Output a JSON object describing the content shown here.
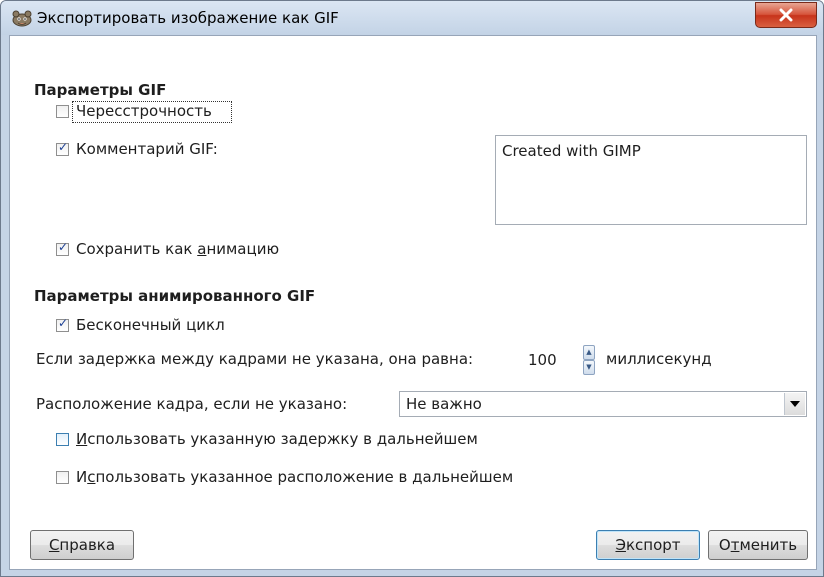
{
  "window": {
    "title": "Экспортировать изображение как GIF",
    "close_label": "X"
  },
  "gif_params": {
    "heading": "Параметры GIF",
    "interlace": {
      "label": "Чересстрочность",
      "checked": false
    },
    "comment": {
      "label": "Комментарий GIF:",
      "checked": true,
      "value": "Created with GIMP"
    },
    "save_animation": {
      "label_pre": "Сохранить как ",
      "label_mnemonic": "а",
      "label_post": "нимацию",
      "checked": true
    }
  },
  "animation_params": {
    "heading": "Параметры анимированного GIF",
    "loop_forever": {
      "label": "Бесконечный цикл",
      "checked": true
    },
    "delay": {
      "label": "Если задержка между кадрами не указана, она равна:",
      "value": "100",
      "unit": "миллисекунд"
    },
    "disposal": {
      "label": "Расположение кадра, если не указано:",
      "selected": "Не важно"
    },
    "use_delay": {
      "label_mnemonic": "И",
      "label_post": "спользовать указанную задержку в дальнейшем",
      "checked": false
    },
    "use_disposal": {
      "label_pre": "И",
      "label_mnemonic": "с",
      "label_post": "пользовать указанное расположение в дальнейшем",
      "checked": false
    }
  },
  "buttons": {
    "help": {
      "mnemonic": "С",
      "rest": "правка"
    },
    "export": {
      "mnemonic": "Э",
      "rest": "кспорт"
    },
    "cancel": {
      "pre": "О",
      "mnemonic": "т",
      "rest": "менить"
    }
  }
}
